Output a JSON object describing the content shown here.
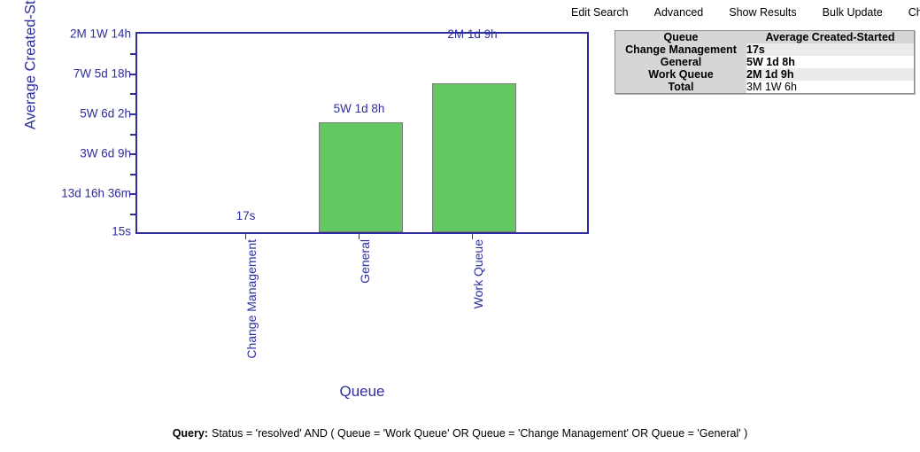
{
  "top_nav": {
    "items": [
      {
        "label": "Edit Search"
      },
      {
        "label": "Advanced"
      },
      {
        "label": "Show Results"
      },
      {
        "label": "Bulk Update"
      },
      {
        "label": "Ch"
      }
    ]
  },
  "chart_data": {
    "type": "bar",
    "title": "",
    "xlabel": "Queue",
    "ylabel": "Average Created-Started",
    "categories": [
      "Change Management",
      "General",
      "Work Queue"
    ],
    "values": [
      17,
      3055000,
      5274000
    ],
    "value_labels": [
      "17s",
      "5W 1d 8h",
      "2M 1d 9h"
    ],
    "bar_color": "#63c863",
    "axis_color": "#2e2e9c",
    "grid": false,
    "legend": "none",
    "ylim": [
      15,
      5443000
    ],
    "ytick_labels": [
      "2M 1W 14h",
      "7W 5d 18h",
      "5W 6d 2h",
      "3W 6d 9h",
      "13d 16h 36m",
      "15s"
    ]
  },
  "results_table": {
    "headers": [
      "Queue",
      "Average Created-Started"
    ],
    "rows": [
      {
        "queue": "Change Management",
        "value": "17s",
        "bold": true
      },
      {
        "queue": "General",
        "value": "5W 1d 8h",
        "bold": true
      },
      {
        "queue": "Work Queue",
        "value": "2M 1d 9h",
        "bold": true
      },
      {
        "queue": "Total",
        "value": "3M 1W 6h",
        "bold": false
      }
    ]
  },
  "query": {
    "label": "Query:",
    "text": "Status = 'resolved' AND ( Queue = 'Work Queue' OR Queue = 'Change Management' OR Queue = 'General' )"
  }
}
